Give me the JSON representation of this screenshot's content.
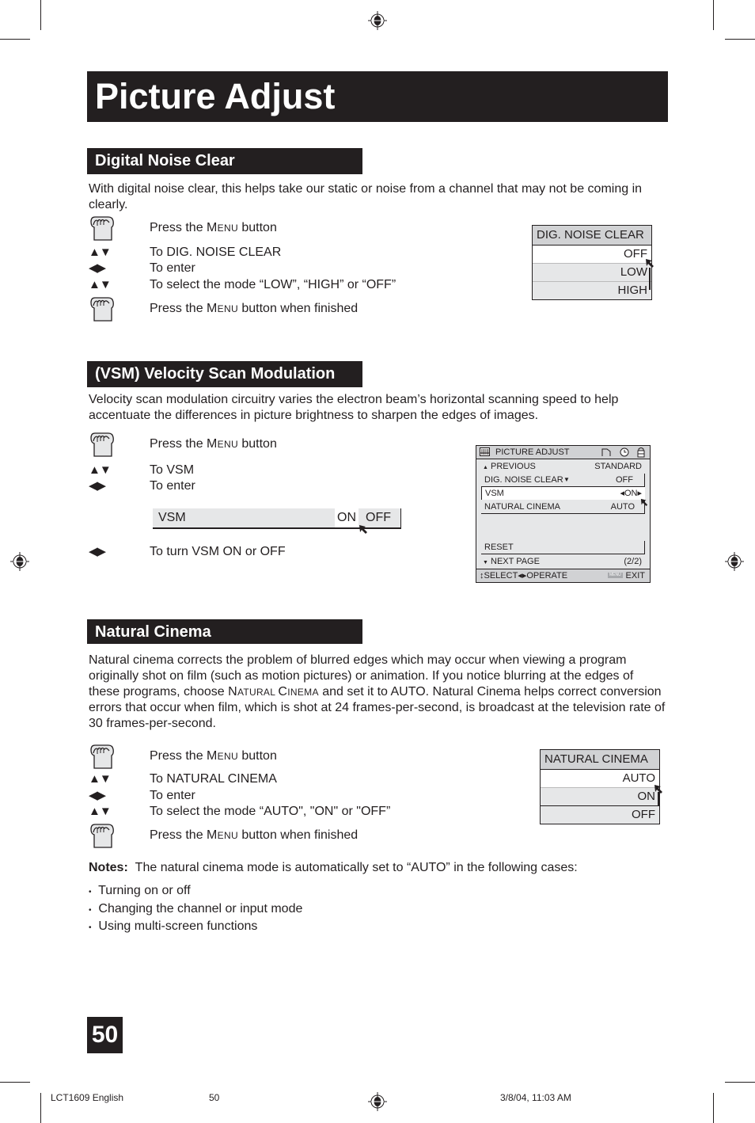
{
  "page": {
    "title": "Picture Adjust",
    "page_number": "50"
  },
  "sections": {
    "dnc": {
      "heading": "Digital Noise Clear",
      "description": "With digital noise clear, this helps take our static or noise from a channel that may not be coming in clearly.",
      "steps": [
        {
          "icon": "hand-press-icon",
          "pre": "Press the ",
          "sc": "Menu",
          "post": " button"
        },
        {
          "icon": "up-down-arrows-icon",
          "text": "To DIG. NOISE CLEAR"
        },
        {
          "icon": "left-right-arrows-icon",
          "text": "To enter"
        },
        {
          "icon": "up-down-arrows-icon",
          "text": "To select the mode “LOW”,  “HIGH” or “OFF”"
        },
        {
          "icon": "hand-press-icon",
          "pre": "Press the ",
          "sc": "Menu",
          "post": " button when finished"
        }
      ],
      "osd": {
        "header": "DIG. NOISE CLEAR",
        "options": [
          "OFF",
          "LOW",
          "HIGH"
        ],
        "selected": "OFF"
      }
    },
    "vsm": {
      "heading": "(VSM) Velocity Scan Modulation",
      "description": "Velocity scan modulation circuitry varies the electron beam’s horizontal scanning speed to help accentuate the differences in picture brightness to sharpen the edges of images.",
      "steps": [
        {
          "icon": "hand-press-icon",
          "pre": "Press the ",
          "sc": "Menu",
          "post": " button"
        },
        {
          "icon": "up-down-arrows-icon",
          "text": "To VSM"
        },
        {
          "icon": "left-right-arrows-icon",
          "text": "To enter"
        },
        {
          "icon": "left-right-arrows-icon",
          "text": "To turn VSM ON or OFF"
        }
      ],
      "osd_bar": {
        "label": "VSM",
        "options": [
          "ON",
          "OFF"
        ],
        "selected": "ON"
      },
      "menu_screen": {
        "title": "PICTURE ADJUST",
        "previous_label": "PREVIOUS",
        "previous_value": "STANDARD",
        "items": [
          {
            "label": "DIG. NOISE CLEAR",
            "value": "OFF"
          },
          {
            "label": "VSM",
            "value": "ON"
          },
          {
            "label": "NATURAL CINEMA",
            "value": "AUTO"
          }
        ],
        "reset_label": "RESET",
        "next_page_label": "NEXT PAGE",
        "page_indicator": "(2/2)",
        "select_label": "SELECT",
        "operate_label": "OPERATE",
        "menu_badge": "MENU",
        "exit_label": "EXIT"
      }
    },
    "nc": {
      "heading": "Natural Cinema",
      "description_parts": {
        "a": "Natural cinema corrects the problem of blurred edges which may occur when viewing a program originally shot on film (such as motion pictures) or animation. If you notice blurring at the edges of these programs, choose ",
        "sc": "Natural Cinema",
        "b": " and set it to AUTO. Natural Cinema helps correct conversion errors that occur when film, which is shot at 24 frames-per-second, is broadcast at the television rate of 30 frames-per-second."
      },
      "steps": [
        {
          "icon": "hand-press-icon",
          "pre": "Press the ",
          "sc": "Menu",
          "post": " button"
        },
        {
          "icon": "up-down-arrows-icon",
          "text": "To NATURAL CINEMA"
        },
        {
          "icon": "left-right-arrows-icon",
          "text": "To enter"
        },
        {
          "icon": "up-down-arrows-icon",
          "text": "To select the mode “AUTO\", \"ON\" or \"OFF”"
        },
        {
          "icon": "hand-press-icon",
          "pre": "Press the ",
          "sc": "Menu",
          "post": " button when finished"
        }
      ],
      "osd": {
        "header": "NATURAL CINEMA",
        "options": [
          "AUTO",
          "ON",
          "OFF"
        ],
        "selected": "AUTO"
      },
      "notes_label": "Notes:",
      "notes_text": "The natural cinema mode is automatically set to “AUTO” in the following cases:",
      "notes_items": [
        "Turning on or off",
        "Changing the channel or input mode",
        "Using multi-screen functions"
      ]
    }
  },
  "footer": {
    "doc": "LCT1609 English",
    "page": "50",
    "timestamp": "3/8/04, 11:03 AM"
  },
  "glyphs": {
    "up_down": "▲▼",
    "left_right": "◀▶",
    "bullet": "•",
    "tri_up": "▲",
    "tri_down": "▼",
    "small_lr": "◂▸",
    "ud_small": "↕"
  }
}
